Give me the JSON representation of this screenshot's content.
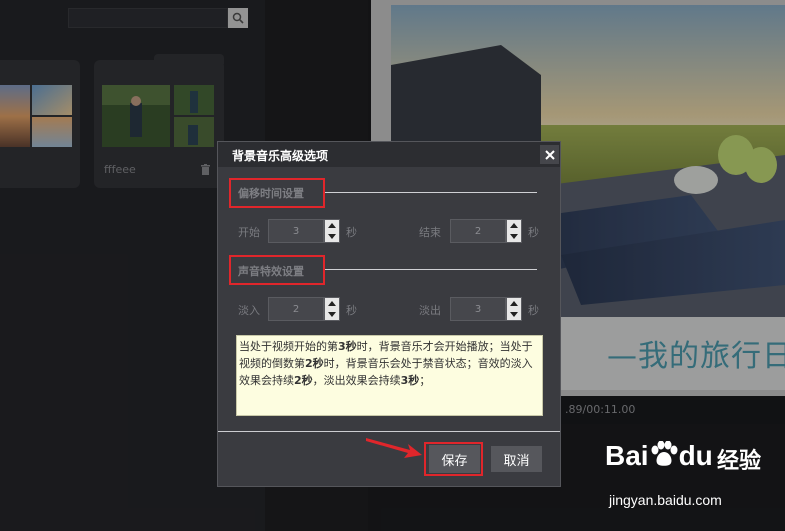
{
  "library": {
    "folder_name": "fffeee"
  },
  "preview": {
    "caption": "—我的旅行日",
    "time": ".89/00:11.00"
  },
  "dialog": {
    "title": "背景音乐高级选项",
    "offset_section": "偏移时间设置",
    "start_label": "开始",
    "start_value": "3",
    "start_unit": "秒",
    "end_label": "结束",
    "end_value": "2",
    "end_unit": "秒",
    "effect_section": "声音特效设置",
    "fadein_label": "淡入",
    "fadein_value": "2",
    "fadein_unit": "秒",
    "fadeout_label": "淡出",
    "fadeout_value": "3",
    "fadeout_unit": "秒",
    "info": {
      "p1": "当处于视频开始的第",
      "b1": "3秒",
      "p2": "时，背景音乐才会开始播放；当处于视频的倒数第",
      "b2": "2秒",
      "p3": "时，背景音乐会处于禁音状态；音效的淡入效果会持续",
      "b3": "2秒",
      "p4": "，淡出效果会持续",
      "b4": "3秒",
      "p5": "；"
    },
    "save": "保存",
    "cancel": "取消"
  },
  "watermark": {
    "brand": "Bai",
    "brand_suffix": "du",
    "product": "经验",
    "url": "jingyan.baidu.com"
  },
  "colors": {
    "highlight_red": "#e0262b",
    "caption_blue": "#4f9fb3",
    "info_bg": "#fdfde0"
  }
}
